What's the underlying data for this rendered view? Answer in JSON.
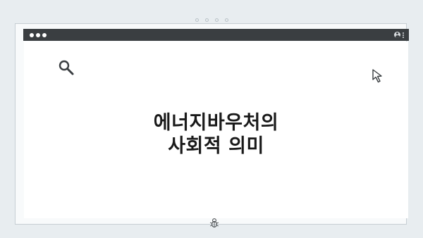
{
  "window": {
    "accent_color": "#3a3e41",
    "background_color": "#ffffff"
  },
  "icons": {
    "search": "search-icon",
    "cursor": "cursor-arrow-icon",
    "user": "user-icon",
    "menu": "kebab-menu-icon",
    "bug": "bug-icon"
  },
  "headline": {
    "line1": "에너지바우처의",
    "line2": "사회적 의미"
  }
}
